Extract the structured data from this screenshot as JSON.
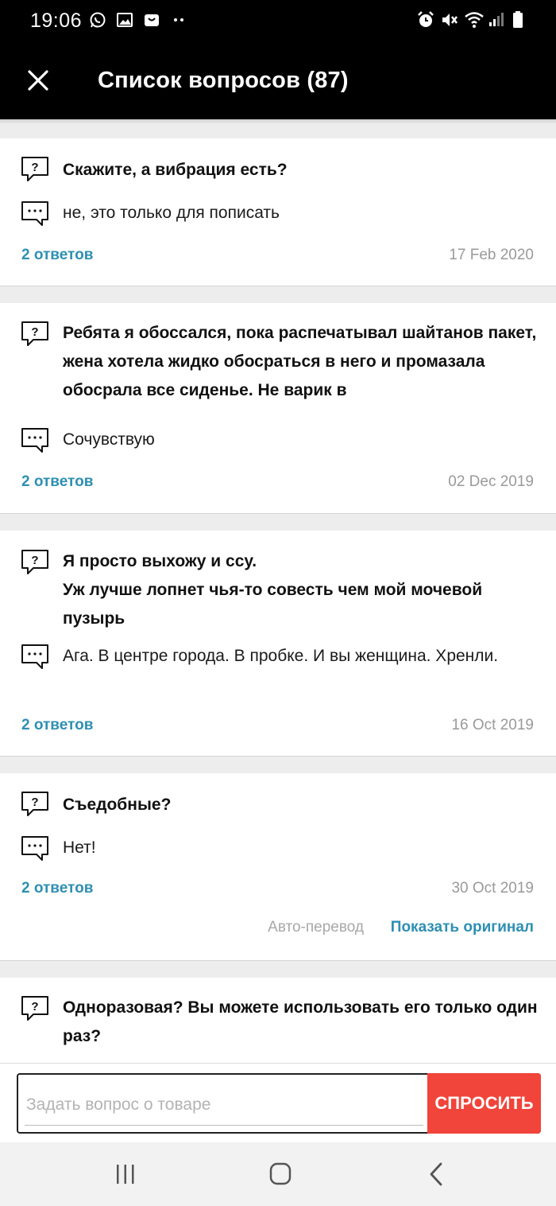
{
  "status_bar": {
    "time": "19:06",
    "left_icons": [
      "whatsapp-icon",
      "gallery-icon",
      "bag-icon",
      "more-dots-icon"
    ],
    "right_icons": [
      "alarm-icon",
      "mute-icon",
      "wifi-icon",
      "signal-icon",
      "battery-icon"
    ]
  },
  "header": {
    "title": "Список вопросов (87)",
    "close_icon": "close-icon"
  },
  "questions": [
    {
      "question": "Скажите, а вибрация есть?",
      "answer": "не, это только для пописать",
      "answers_link": "2 ответов",
      "date": "17 Feb 2020"
    },
    {
      "question": "Ребята я обоссался, пока распечатывал шайтанов пакет, жена хотела жидко обосраться в него и промазала обосрала все сиденье. Не варик в",
      "answer": "Сочувствую",
      "answers_link": "2 ответов",
      "date": "02 Dec 2019"
    },
    {
      "question_line1": "Я просто выхожу и ссу.",
      "question_line2": "Уж лучше лопнет чья-то совесть чем мой мочевой пузырь",
      "answer": "Ага. В центре города. В пробке. И вы женщина. Хренли.",
      "answers_link": "2 ответов",
      "date": "16 Oct 2019"
    },
    {
      "question": "Съедобные?",
      "answer": "Нет!",
      "answers_link": "2 ответов",
      "date": "30 Oct 2019",
      "auto_translate_label": "Авто-перевод",
      "show_original_label": "Показать оригинал"
    },
    {
      "question": "Одноразовая? Вы можете использовать его только один раз?"
    }
  ],
  "ask_bar": {
    "placeholder": "Задать вопрос о товаре",
    "button_label": "СПРОСИТЬ"
  },
  "nav_bar": {
    "icons": [
      "recent-apps-icon",
      "home-icon",
      "back-icon"
    ]
  },
  "colors": {
    "accent_link": "#2e8fb3",
    "ask_button": "#f1443a",
    "header_bg": "#000000"
  }
}
